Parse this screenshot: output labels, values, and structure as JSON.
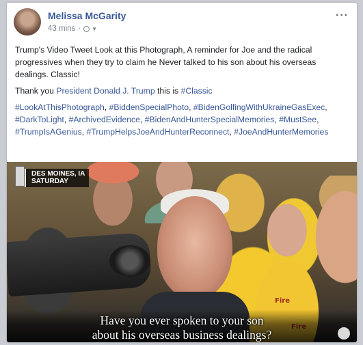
{
  "post": {
    "author": "Melissa McGarity",
    "timestamp": "43 mins",
    "separator": "·",
    "privacy_icon": "globe-icon",
    "menu_icon": "more-options-icon",
    "more_label": "···"
  },
  "message": {
    "paragraph1": "Trump's Video Tweet Look at this Photograph, A reminder for Joe and the radical progressives when they try to claim he Never talked to his son about his overseas dealings. Classic!",
    "thanks_prefix": "Thank you",
    "thanks_mention": "President Donald J. Trump",
    "thanks_middle": "this is",
    "thanks_tag": "#Classic",
    "hashtags": [
      "#LookAtThisPhotograph",
      "#BiddenSpecialPhoto",
      "#BidenGolfingWithUkraineGasExec",
      "#DarkToLight",
      "#ArchivedEvidence",
      "#BidenAndHunterSpecialMemories",
      "#MustSee",
      "#TrumpIsAGenius",
      "#TrumpHelpsJoeAndHunterReconnect",
      "#JoeAndHunterMemories"
    ]
  },
  "video": {
    "location_line1": "DES MOINES, IA",
    "location_line2": "SATURDAY",
    "caption_line1": "Have you ever spoken to your son",
    "caption_line2": "about his overseas business dealings?",
    "shirt_text": "Fire"
  },
  "colors": {
    "link": "#385898",
    "text": "#1c1e21",
    "meta": "#7a7f88"
  }
}
